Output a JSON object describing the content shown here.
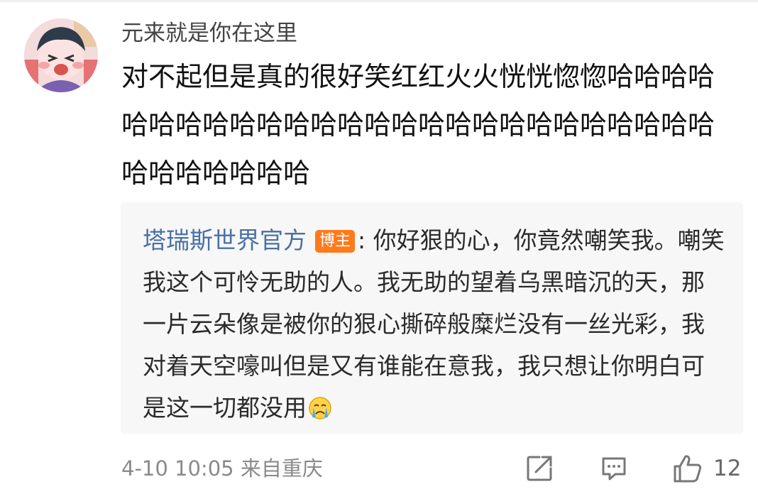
{
  "comment": {
    "username": "元来就是你在这里",
    "text": "对不起但是真的很好笑红红火火恍恍惚惚哈哈哈哈哈哈哈哈哈哈哈哈哈哈哈哈哈哈哈哈哈哈哈哈哈哈哈哈哈哈哈哈哈"
  },
  "reply": {
    "author": "塔瑞斯世界官方",
    "badge": "博主",
    "separator": ":",
    "text": " 你好狠的心，你竟然嘲笑我。嘲笑我这个可怜无助的人。我无助的望着乌黑暗沉的天，那一片云朵像是被你的狠心撕碎般糜烂没有一丝光彩，我对着天空嚎叫但是又有谁能在意我，我只想让你明白可是这一切都没用"
  },
  "footer": {
    "time_location": "4-10 10:05 来自重庆",
    "like_count": "12"
  },
  "icons": {
    "share": "share-icon",
    "reply": "comment-icon",
    "like": "thumbs-up-icon",
    "emoji": "crying-emoji-icon"
  },
  "colors": {
    "author_link": "#4a6fa5",
    "badge_bg": "#ff7a1a",
    "reply_bg": "#f7f7f7",
    "meta_text": "#8a8a8a"
  }
}
